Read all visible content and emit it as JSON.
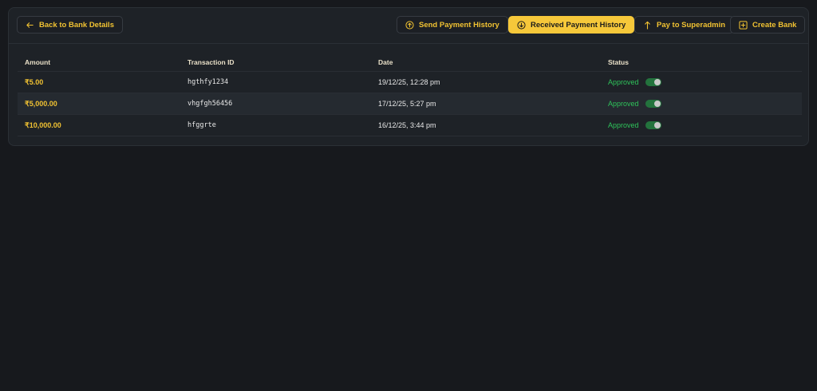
{
  "toolbar": {
    "back_label": "Back to Bank Details",
    "send_history_label": "Send Payment History",
    "received_history_label": "Received Payment History",
    "pay_superadmin_label": "Pay to Superadmin",
    "create_bank_label": "Create Bank"
  },
  "table": {
    "columns": [
      "Amount",
      "Transaction ID",
      "Date",
      "Status"
    ],
    "rows": [
      {
        "amount": "₹5.00",
        "transaction_id": "hgthfy1234",
        "date": "19/12/25, 12:28 pm",
        "status": "Approved",
        "toggle_on": true
      },
      {
        "amount": "₹5,000.00",
        "transaction_id": "vhgfgh56456",
        "date": "17/12/25, 5:27 pm",
        "status": "Approved",
        "toggle_on": true
      },
      {
        "amount": "₹10,000.00",
        "transaction_id": "hfggrte",
        "date": "16/12/25, 3:44 pm",
        "status": "Approved",
        "toggle_on": true
      }
    ]
  },
  "colors": {
    "accent": "#f6c83a",
    "status_approved": "#2ec25a",
    "background": "#17191d",
    "panel": "#1e2227"
  },
  "icons": {
    "back": "arrow-left-icon",
    "send": "arrow-up-circle-icon",
    "received": "arrow-down-circle-icon",
    "pay": "arrow-up-icon",
    "create": "plus-square-icon"
  }
}
